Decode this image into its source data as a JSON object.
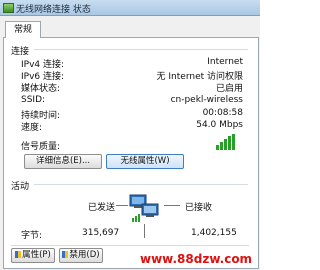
{
  "window": {
    "title": "无线网络连接 状态"
  },
  "tabs": [
    {
      "label": "常规"
    }
  ],
  "connection": {
    "section_title": "连接",
    "rows": [
      {
        "label": "IPv4 连接:",
        "value": "Internet"
      },
      {
        "label": "IPv6 连接:",
        "value": "无 Internet 访问权限"
      },
      {
        "label": "媒体状态:",
        "value": "已启用"
      },
      {
        "label": "SSID:",
        "value": "cn-pekl-wireless"
      },
      {
        "label": "持续时间:",
        "value": "00:08:58"
      },
      {
        "label": "速度:",
        "value": "54.0 Mbps"
      }
    ],
    "signal_label": "信号质量:",
    "signal_level": "5/5",
    "details_button": "详细信息(E)...",
    "wireless_props_button": "无线属性(W)"
  },
  "activity": {
    "section_title": "活动",
    "sent_label": "已发送",
    "received_label": "已接收",
    "bytes_label": "字节:",
    "bytes_sent": "315,697",
    "bytes_received": "1,402,155"
  },
  "footer": {
    "properties_button": "属性(P)",
    "disable_button": "禁用(D)"
  },
  "watermark": "www.88dzw.com",
  "colors": {
    "signal": "#28a028",
    "watermark": "#e01010"
  },
  "icons": {
    "title": "network-icon",
    "signal": "signal-bars-icon",
    "activity": "network-computers-icon",
    "shield": "uac-shield-icon"
  }
}
